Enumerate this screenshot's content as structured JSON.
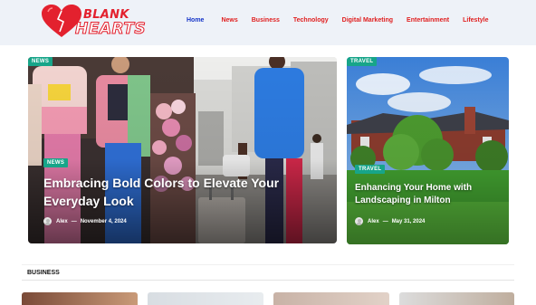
{
  "brand": {
    "line1": "BLANK",
    "line2": "HEARTS",
    "accent": "#e3212e"
  },
  "nav": {
    "items": [
      {
        "label": "Home",
        "active": true
      },
      {
        "label": "News"
      },
      {
        "label": "Business"
      },
      {
        "label": "Technology"
      },
      {
        "label": "Digital Marketing"
      },
      {
        "label": "Entertainment"
      },
      {
        "label": "Lifestyle"
      }
    ]
  },
  "hero": {
    "main": {
      "top_tag": "NEWS",
      "tag": "NEWS",
      "title_line1": "Embracing Bold Colors to Elevate Your",
      "title_line2": "Everyday Look",
      "author": "Alex",
      "date": "November 4, 2024"
    },
    "side": {
      "top_tag": "TRAVEL",
      "tag": "TRAVEL",
      "title_line1": "Enhancing Your Home with",
      "title_line2": "Landscaping in Milton",
      "author": "Alex",
      "date": "May 31, 2024"
    }
  },
  "section": {
    "title": "BUSINESS"
  },
  "colors": {
    "tag": "#17a589",
    "nav_active": "#1434c8",
    "nav": "#e02020",
    "header_bg": "#eef2f8"
  }
}
